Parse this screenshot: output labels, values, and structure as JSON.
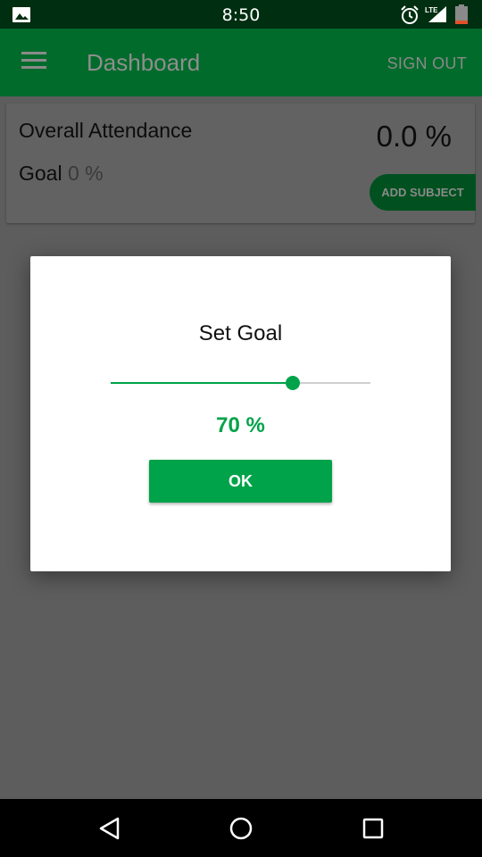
{
  "status_bar": {
    "time": "8:50",
    "network": "LTE",
    "icons": [
      "gallery-icon",
      "alarm-icon",
      "signal-icon",
      "battery-icon"
    ]
  },
  "app_bar": {
    "menu_icon": "menu-icon",
    "title": "Dashboard",
    "sign_out_label": "SIGN OUT"
  },
  "card": {
    "overall_label": "Overall Attendance",
    "overall_value": "0.0 %",
    "goal_label": "Goal",
    "goal_value": "0 %",
    "add_subject_label": "ADD SUBJECT"
  },
  "dialog": {
    "title": "Set Goal",
    "slider_value": 70,
    "slider_max": 100,
    "goal_text": "70 %",
    "ok_label": "OK"
  },
  "nav_bar": {
    "icons": [
      "back-icon",
      "home-icon",
      "recents-icon"
    ]
  },
  "colors": {
    "accent": "#00a349",
    "app_bar": "#006b2b",
    "status_bar": "#002e10",
    "scrim": "#5d5d5d"
  }
}
